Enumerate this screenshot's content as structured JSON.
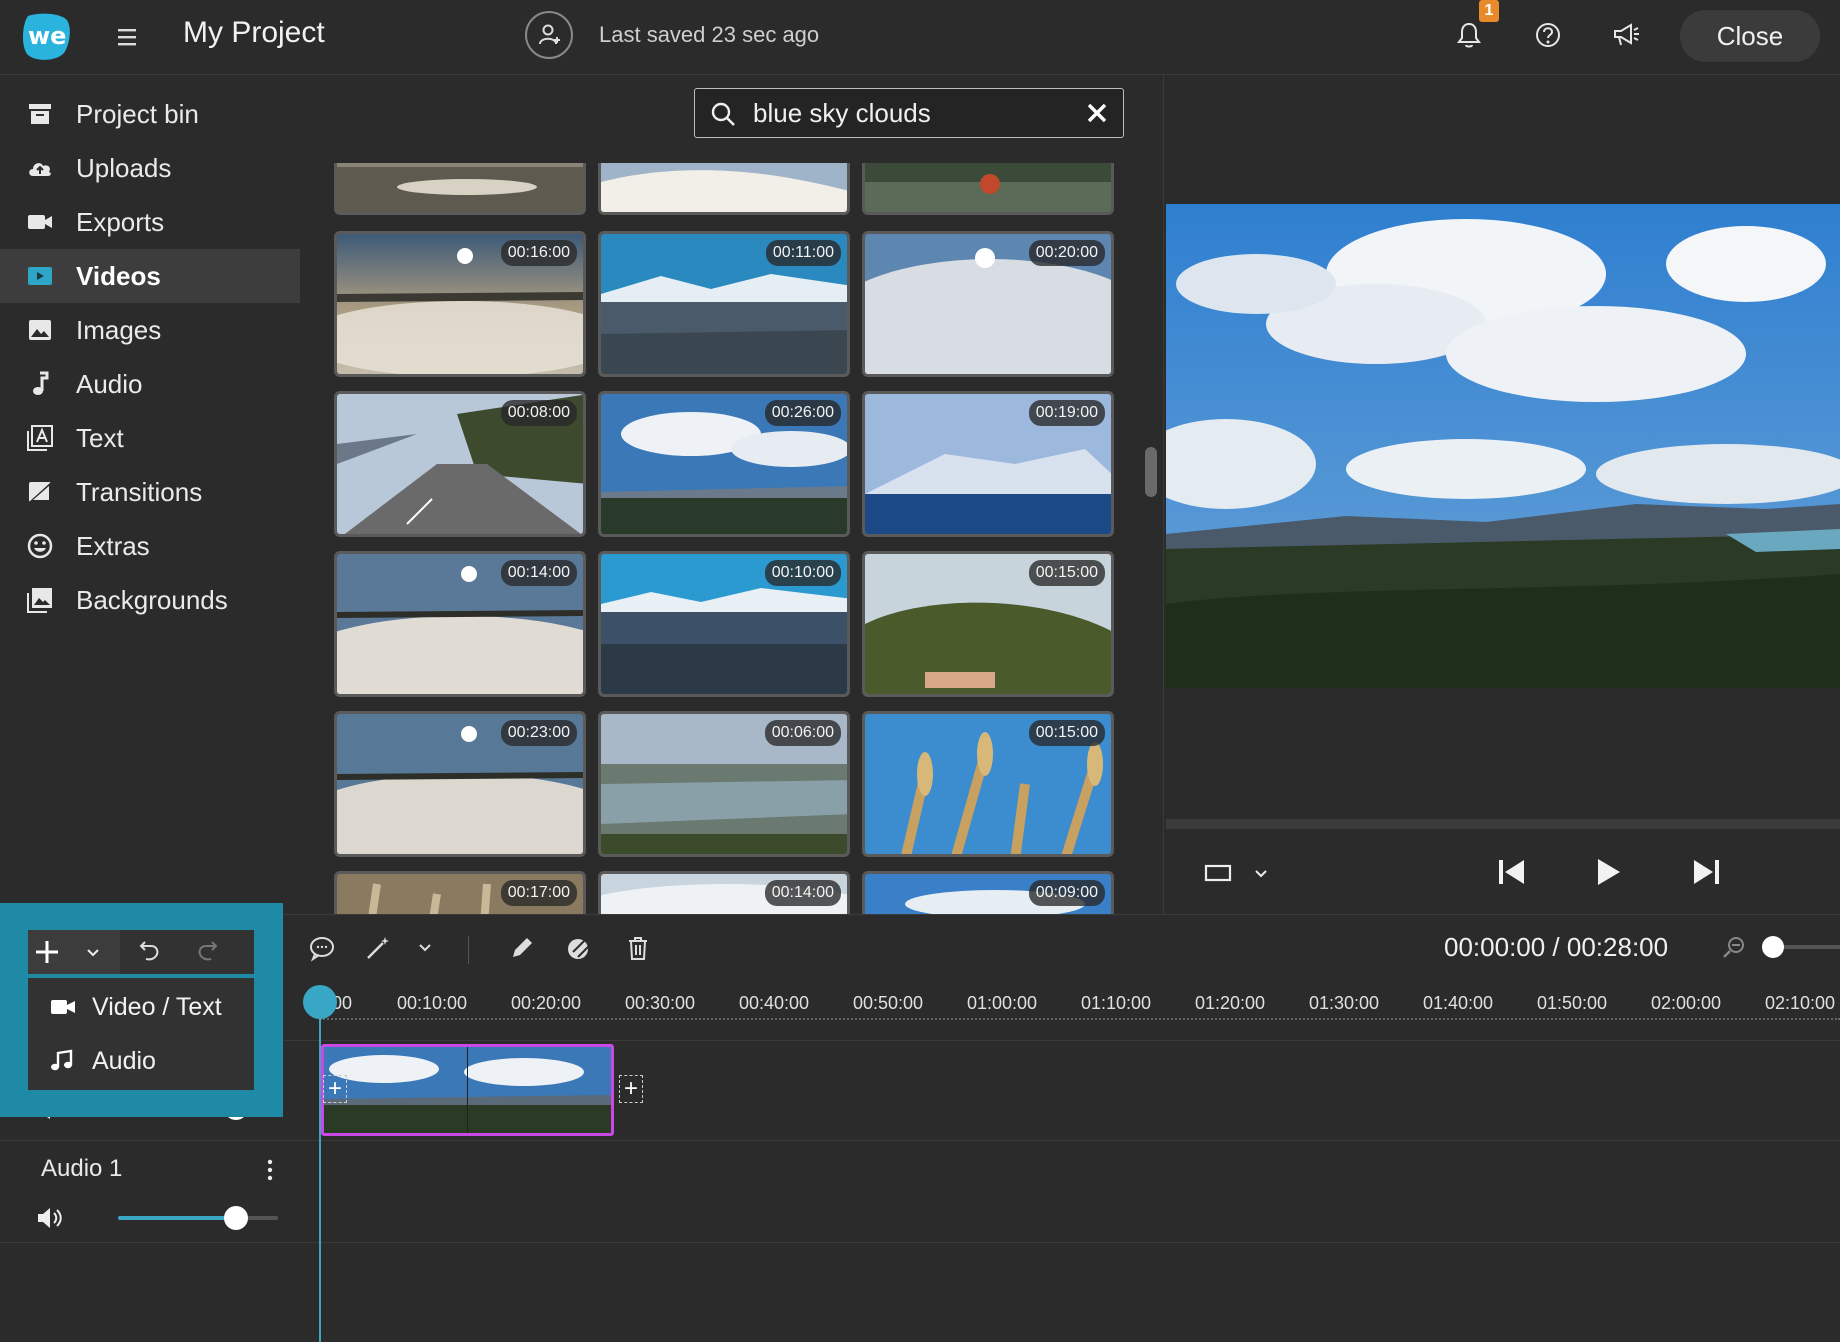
{
  "header": {
    "project_title": "My Project",
    "saved_status": "Last saved 23 sec ago",
    "notification_count": "1",
    "close_label": "Close"
  },
  "sidebar": {
    "items": [
      {
        "label": "Project bin",
        "icon": "archive-icon"
      },
      {
        "label": "Uploads",
        "icon": "cloud-upload-icon"
      },
      {
        "label": "Exports",
        "icon": "video-camera-icon"
      },
      {
        "label": "Videos",
        "icon": "video-play-icon",
        "active": true
      },
      {
        "label": "Images",
        "icon": "image-icon"
      },
      {
        "label": "Audio",
        "icon": "music-note-icon"
      },
      {
        "label": "Text",
        "icon": "text-icon"
      },
      {
        "label": "Transitions",
        "icon": "transition-icon"
      },
      {
        "label": "Extras",
        "icon": "smiley-icon"
      },
      {
        "label": "Backgrounds",
        "icon": "backgrounds-icon"
      }
    ]
  },
  "search": {
    "value": "blue sky clouds"
  },
  "media_grid": {
    "thumbnails": [
      {
        "duration": ""
      },
      {
        "duration": ""
      },
      {
        "duration": ""
      },
      {
        "duration": "00:16:00"
      },
      {
        "duration": "00:11:00"
      },
      {
        "duration": "00:20:00"
      },
      {
        "duration": "00:08:00"
      },
      {
        "duration": "00:26:00"
      },
      {
        "duration": "00:19:00"
      },
      {
        "duration": "00:14:00"
      },
      {
        "duration": "00:10:00"
      },
      {
        "duration": "00:15:00"
      },
      {
        "duration": "00:23:00"
      },
      {
        "duration": "00:06:00"
      },
      {
        "duration": "00:15:00"
      },
      {
        "duration": "00:17:00"
      },
      {
        "duration": "00:14:00"
      },
      {
        "duration": "00:09:00"
      }
    ]
  },
  "timeline": {
    "time_display": "00:00:00 / 00:28:00",
    "ruler_labels": [
      "00",
      "00:10:00",
      "00:20:00",
      "00:30:00",
      "00:40:00",
      "00:50:00",
      "01:00:00",
      "01:10:00",
      "01:20:00",
      "01:30:00",
      "01:40:00",
      "01:50:00",
      "02:00:00",
      "02:10:00"
    ],
    "audio_track_label": "Audio 1",
    "volume_level": 0.74
  },
  "add_menu": {
    "items": [
      {
        "label": "Video / Text",
        "icon": "video-camera-icon"
      },
      {
        "label": "Audio",
        "icon": "music-note-icon"
      }
    ]
  },
  "colors": {
    "accent": "#3aa6c6",
    "clip_border": "#c948e6",
    "badge": "#e8892a",
    "popup_highlight": "#1f8aa6"
  }
}
